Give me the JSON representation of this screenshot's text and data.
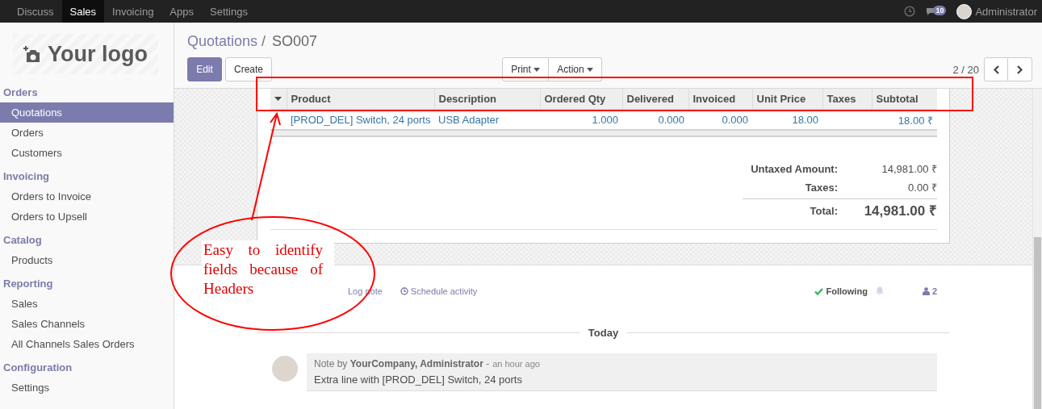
{
  "top_menu": [
    {
      "label": "Discuss",
      "selected": false
    },
    {
      "label": "Sales",
      "selected": true
    },
    {
      "label": "Invoicing",
      "selected": false
    },
    {
      "label": "Apps",
      "selected": false
    },
    {
      "label": "Settings",
      "selected": false
    }
  ],
  "systray": {
    "message_count": "10",
    "user_name": "Administrator"
  },
  "logo": {
    "text": "Your logo"
  },
  "sidebar": {
    "sections": [
      {
        "title": "Orders",
        "items": [
          {
            "label": "Quotations",
            "selected": true
          },
          {
            "label": "Orders",
            "selected": false
          },
          {
            "label": "Customers",
            "selected": false
          }
        ]
      },
      {
        "title": "Invoicing",
        "items": [
          {
            "label": "Orders to Invoice",
            "selected": false
          },
          {
            "label": "Orders to Upsell",
            "selected": false
          }
        ]
      },
      {
        "title": "Catalog",
        "items": [
          {
            "label": "Products",
            "selected": false
          }
        ]
      },
      {
        "title": "Reporting",
        "items": [
          {
            "label": "Sales",
            "selected": false
          },
          {
            "label": "Sales Channels",
            "selected": false
          },
          {
            "label": "All Channels Sales Orders",
            "selected": false
          }
        ]
      },
      {
        "title": "Configuration",
        "items": [
          {
            "label": "Settings",
            "selected": false
          }
        ]
      }
    ]
  },
  "breadcrumb": {
    "parent": "Quotations",
    "separator": "/",
    "current": "SO007"
  },
  "buttons": {
    "edit": "Edit",
    "create": "Create",
    "print": "Print",
    "action": "Action"
  },
  "pager": "2 / 20",
  "order_lines": {
    "columns": [
      {
        "label": "Product",
        "kind": "text"
      },
      {
        "label": "Description",
        "kind": "text"
      },
      {
        "label": "Ordered Qty",
        "kind": "number"
      },
      {
        "label": "Delivered",
        "kind": "number"
      },
      {
        "label": "Invoiced",
        "kind": "number"
      },
      {
        "label": "Unit Price",
        "kind": "number"
      },
      {
        "label": "Taxes",
        "kind": "text"
      },
      {
        "label": "Subtotal",
        "kind": "number"
      }
    ],
    "rows": [
      {
        "cells": [
          "[PROD_DEL] Switch, 24 ports",
          "USB Adapter",
          "1.000",
          "0.000",
          "0.000",
          "18.00",
          "",
          "18.00 ₹"
        ]
      }
    ]
  },
  "totals": [
    {
      "kind": "line",
      "label": "Untaxed Amount:",
      "value": "14,981.00 ₹"
    },
    {
      "kind": "line",
      "label": "Taxes:",
      "value": "0.00 ₹"
    },
    {
      "kind": "grand",
      "label": "Total:",
      "value": "14,981.00 ₹"
    }
  ],
  "chatter": {
    "log_note": "Log note",
    "schedule_activity": "Schedule activity",
    "following": "Following",
    "followers": "2",
    "date": "Today",
    "messages": [
      {
        "header": "Note by **YourCompany, Administrator** -",
        "time": "an hour ago",
        "body": "Extra line with [PROD_DEL] Switch, 24 ports"
      }
    ]
  },
  "annotation": {
    "text": "Easy to identify fields because of Headers"
  }
}
